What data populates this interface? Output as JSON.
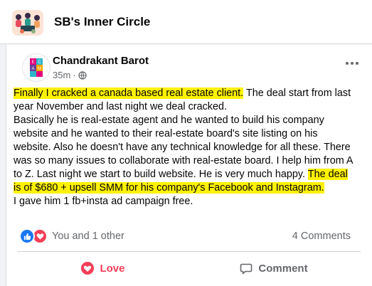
{
  "group": {
    "name": "SB's Inner Circle"
  },
  "post": {
    "author": "Chandrakant Barot",
    "time": "35m",
    "dot": "·",
    "privacy_icon": "globe-icon",
    "body": {
      "hl1": "Finally I cracked a canada based real estate client.",
      "text1": " The deal start from last year November and last night we deal cracked.",
      "text2": "Basically he is real-estate agent and he wanted to build his company website and he wanted to their real-estate board's site listing on his website. Also he doesn't have any technical knowledge for all these. There was so many issues to collaborate with real-estate board. I help him from A to Z. Last night we start to build website. He is very much happy. ",
      "hl2": "The deal is of $680 + upsell SMM for his company's Facebook and Instagram.",
      "text3": "I gave him 1 fb+insta ad campaign free."
    },
    "highlight_color": "#fff200",
    "reactions": {
      "icons": [
        "like-icon",
        "love-icon"
      ],
      "text": "You and 1 other"
    },
    "comments_count": "4 Comments",
    "actions": {
      "love_label": "Love",
      "comment_label": "Comment"
    }
  },
  "colors": {
    "love": "#f33e58",
    "like": "#1877f2",
    "secondary_text": "#65676b"
  }
}
